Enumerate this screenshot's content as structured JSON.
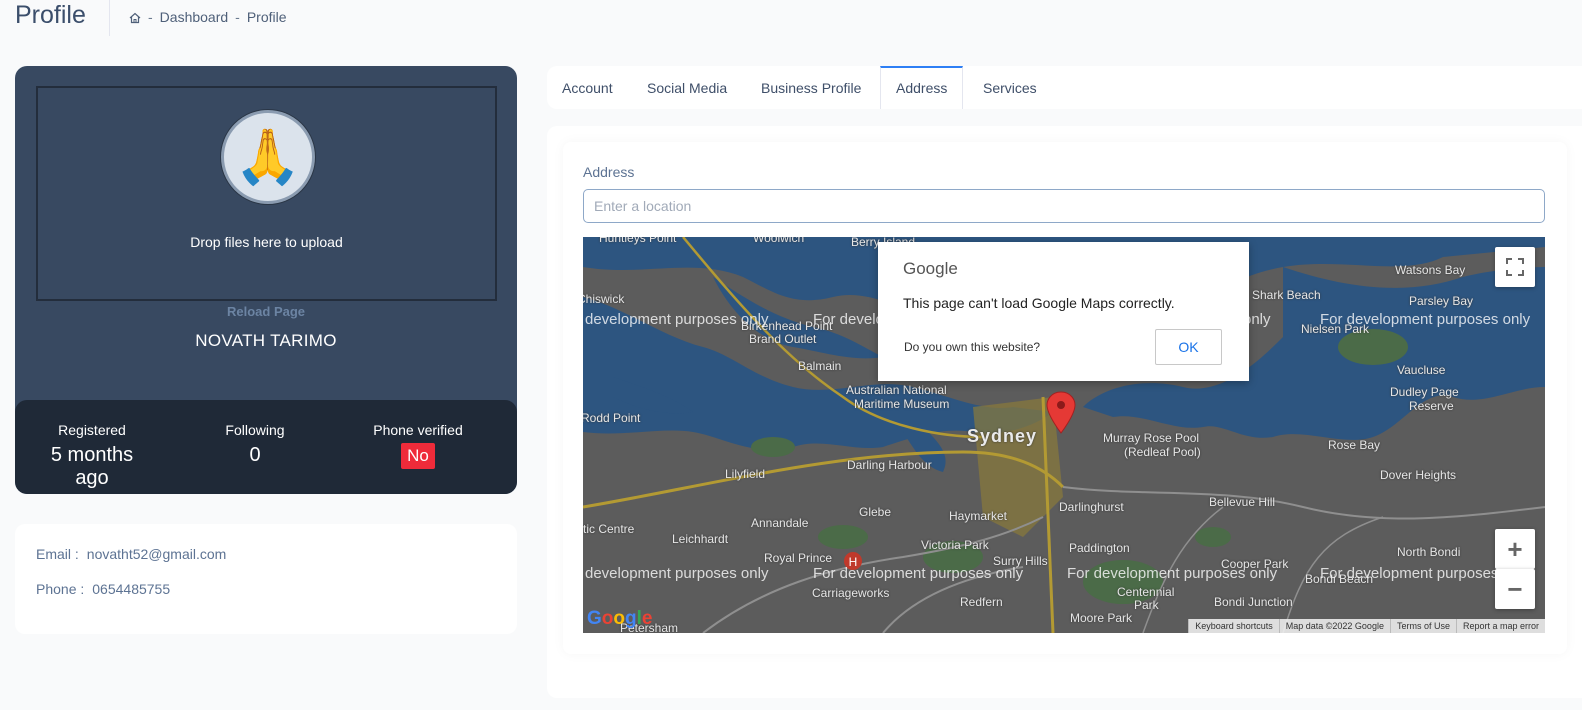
{
  "header": {
    "title": "Profile",
    "breadcrumb": [
      "Dashboard",
      "Profile"
    ],
    "breadcrumb_sep": "-"
  },
  "profile": {
    "drop_text": "Drop files here to upload",
    "reload": "Reload Page",
    "name": "NOVATH TARIMO",
    "avatar_glyph": "🙏",
    "stats": {
      "registered_label": "Registered",
      "registered_value": "5 months ago",
      "following_label": "Following",
      "following_value": "0",
      "phone_label": "Phone verified",
      "phone_value": "No"
    }
  },
  "contact": {
    "email_label": "Email :",
    "email_value": "novatht52@gmail.com",
    "phone_label": "Phone :",
    "phone_value": "0654485755"
  },
  "tabs": [
    {
      "label": "Account"
    },
    {
      "label": "Social Media"
    },
    {
      "label": "Business Profile"
    },
    {
      "label": "Address",
      "active": true
    },
    {
      "label": "Services"
    }
  ],
  "address": {
    "label": "Address",
    "placeholder": "Enter a location"
  },
  "map": {
    "watermark": "For development purposes only",
    "watermark_left": "development purposes only",
    "watermark_right": "For development purposes",
    "watermark_cut": "For develo",
    "watermark_only": "only",
    "places": {
      "sydney": "Sydney",
      "huntleys": "Huntleys Point",
      "woolwich": "Woolwich",
      "berry": "Berry Island",
      "watsons": "Watsons Bay",
      "shark": "Shark Beach",
      "parsley": "Parsley Bay",
      "nielsen": "Nielsen Park",
      "vaucluse": "Vaucluse",
      "dudley": "Dudley Page",
      "reserve": "Reserve",
      "chiswick": "Chiswick",
      "birkenhead": "Birkenhead Point",
      "brand": "Brand Outlet",
      "balmain": "Balmain",
      "maritime1": "Australian National",
      "maritime2": "Maritime Museum",
      "rodd": "Rodd Point",
      "murray1": "Murray Rose Pool",
      "murray2": "(Redleaf Pool)",
      "rosebay": "Rose Bay",
      "darling": "Darling Harbour",
      "lilyfield": "Lilyfield",
      "dover": "Dover Heights",
      "darlinghurst": "Darlinghurst",
      "bellevue": "Bellevue Hill",
      "glebe": "Glebe",
      "haymarket": "Haymarket",
      "annandale": "Annandale",
      "leichhardt": "Leichhardt",
      "victoria": "Victoria Park",
      "paddington": "Paddington",
      "surry": "Surry Hills",
      "cooper": "Cooper Park",
      "northbondi": "North Bondi",
      "bondibeach": "Bondi Beach",
      "centennial1": "Centennial",
      "centennial2": "Park",
      "royal": "Royal Prince",
      "redfern": "Redfern",
      "carriageworks": "Carriageworks",
      "bondijunction": "Bondi Junction",
      "moore": "Moore Park",
      "petersham": "Petersham",
      "ticentre": "tic Centre"
    },
    "dialog": {
      "brand": "Google",
      "message": "This page can't load Google Maps correctly.",
      "question": "Do you own this website?",
      "ok": "OK"
    },
    "footer": [
      "Keyboard shortcuts",
      "Map data ©2022 Google",
      "Terms of Use",
      "Report a map error"
    ],
    "zoom_in": "+",
    "zoom_out": "−",
    "logo": "Google"
  }
}
